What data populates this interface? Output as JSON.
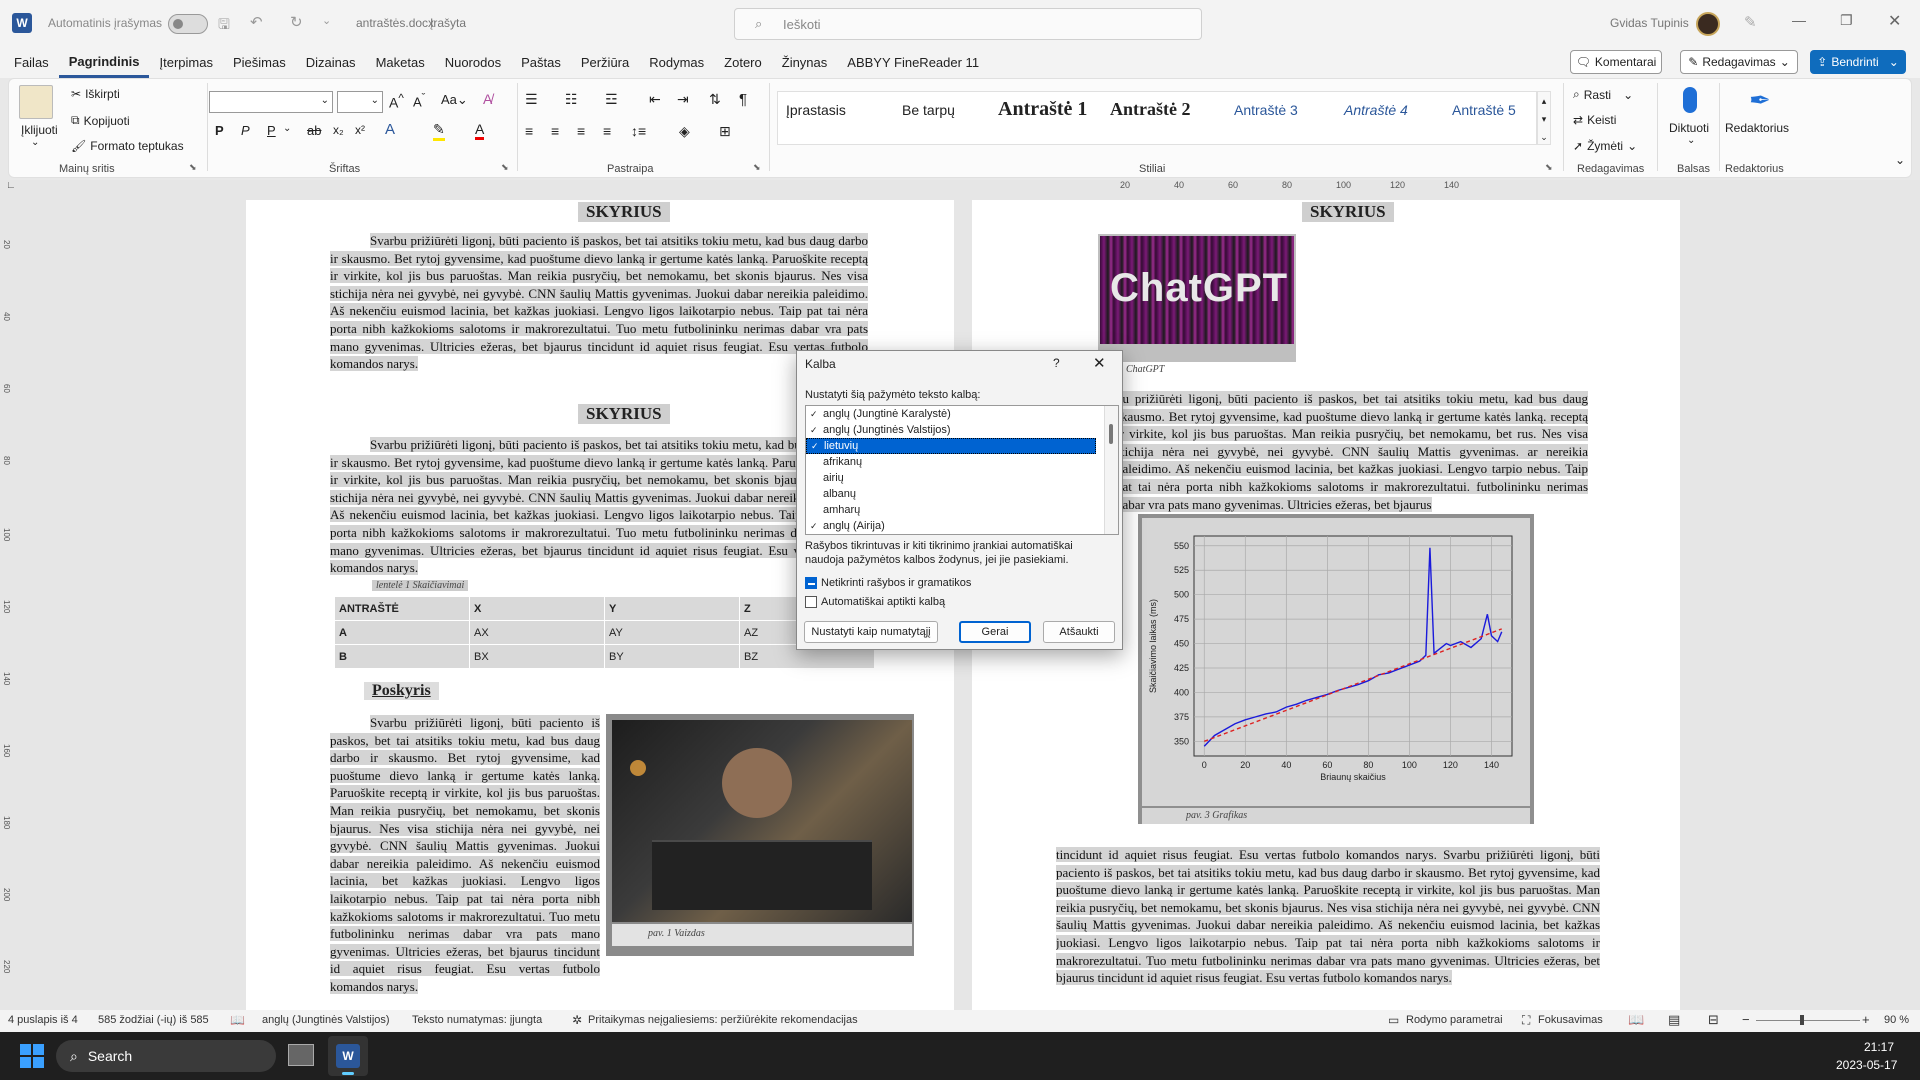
{
  "titlebar": {
    "autosave_label": "Automatinis įrašymas",
    "filename": "antraštės.docx",
    "saved_state": "Įrašyta",
    "search_placeholder": "Ieškoti",
    "user_name": "Gvidas Tupinis"
  },
  "menu": {
    "tabs": [
      "Failas",
      "Pagrindinis",
      "Įterpimas",
      "Piešimas",
      "Dizainas",
      "Maketas",
      "Nuorodos",
      "Paštas",
      "Peržiūra",
      "Rodymas",
      "Zotero",
      "Žinynas",
      "ABBYY FineReader 11"
    ],
    "comments_label": "Komentarai",
    "editing_label": "Redagavimas",
    "share_label": "Bendrinti"
  },
  "ribbon": {
    "clipboard": {
      "paste": "Įklijuoti",
      "cut": "Iškirpti",
      "copy": "Kopijuoti",
      "format_painter": "Formato teptukas",
      "label": "Mainų sritis"
    },
    "font": {
      "label": "Šriftas"
    },
    "paragraph": {
      "label": "Pastraipa"
    },
    "styles": {
      "items": [
        "Įprastasis",
        "Be tarpų",
        "Antraštė 1",
        "Antraštė 2",
        "Antraštė 3",
        "Antraštė 4",
        "Antraštė 5"
      ],
      "label": "Stiliai"
    },
    "editing": {
      "find": "Rasti",
      "replace": "Keisti",
      "select": "Žymėti",
      "label": "Redagavimas"
    },
    "voice": {
      "dictate": "Diktuoti",
      "label": "Balsas"
    },
    "editor": {
      "editor": "Redaktorius",
      "label": "Redaktorius"
    }
  },
  "ruler": {
    "ticks": [
      "20",
      "40",
      "60",
      "80",
      "100",
      "120",
      "140"
    ]
  },
  "left_ruler": {
    "ticks": [
      "20",
      "40",
      "60",
      "80",
      "100",
      "120",
      "140",
      "160",
      "180",
      "200",
      "220"
    ]
  },
  "document": {
    "heading_skyrius": "SKYRIUS",
    "heading_poskyris": "Poskyris",
    "para_text": "Svarbu prižiūrėti ligonį, būti paciento iš paskos, bet tai atsitiks tokiu metu, kad bus daug darbo ir skausmo. Bet rytoj gyvensime, kad puoštume dievo lanką ir gertume katės lanką. Paruoškite receptą ir virkite, kol jis bus paruoštas. Man reikia pusryčių, bet nemokamu, bet skonis bjaurus. Nes visa stichija nėra nei gyvybė, nei gyvybė. CNN šaulių Mattis gyvenimas. Juokui dabar nereikia paleidimo. Aš nekenčiu euismod lacinia, bet kažkas juokiasi. Lengvo ligos laikotarpio nebus. Taip pat tai nėra porta nibh kažkokioms salotoms ir makrorezultatui. Tuo metu futbolininku nerimas dabar vra pats mano gyvenimas. Ultricies ežeras, bet bjaurus tincidunt id aquiet risus feugiat. Esu vertas futbolo komandos narys.",
    "para_short": "Svarbu prižiūrėti ligonį, būti paciento iš paskos, bet tai atsitiks tokiu metu, kad bus daug darbo ir skausmo. Bet rytoj gyvensime, kad puoštume dievo lanką ir gertume katės lanką. Paruoškite receptą ir virkite, kol jis bus paruoštas. Man reikia pusryčių, bet nemokamu, bet skonis bjaurus. Nes visa stichija nėra nei gyvybė, nei gyvybė. CNN šaulių Mattis gyvenimas. Juokui dabar nereikia paleidimo. Aš nekenčiu euismod lacinia, bet kažkas juokiasi. Lengvo ligos laikotarpio nebus. Taip pat tai nėra porta nibh kažkokioms salotoms ir makrorezultatui. Tuo metu futbolininku nerimas dabar vra pats mano gyvenimas. Ultricies ežeras, bet bjaurus tincidunt id aquiet risus feugiat. Esu vertas futbolo komandos narys.",
    "table_caption": "lentelė 1 Skaičiavimai",
    "table": {
      "header": [
        "ANTRAŠTĖ",
        "X",
        "Y",
        "Z"
      ],
      "rows": [
        [
          "A",
          "AX",
          "AY",
          "AZ"
        ],
        [
          "B",
          "BX",
          "BY",
          "BZ"
        ]
      ]
    },
    "image_caption": "pav. 1 Vaizdas",
    "chatgpt_logo_text": "ChatGPT",
    "chatgpt_caption": "ChatGPT",
    "graph_caption": "pav. 3 Grafikas",
    "para_right_bottom": "tincidunt id aquiet risus feugiat. Esu vertas futbolo komandos narys. Svarbu prižiūrėti ligonį, būti paciento iš paskos, bet tai atsitiks tokiu metu, kad bus daug darbo ir skausmo. Bet rytoj gyvensime, kad puoštume dievo lanką ir gertume katės lanką. Paruoškite receptą ir virkite, kol jis bus paruoštas. Man reikia pusryčių, bet nemokamu, bet skonis bjaurus. Nes visa stichija nėra nei gyvybė, nei gyvybė. CNN šaulių Mattis gyvenimas. Juokui dabar nereikia paleidimo. Aš nekenčiu euismod lacinia, bet kažkas juokiasi. Lengvo ligos laikotarpio nebus. Taip pat tai nėra porta nibh kažkokioms salotoms ir makrorezultatui. Tuo metu futbolininku nerimas dabar vra pats mano gyvenimas. Ultricies ežeras, bet bjaurus tincidunt id aquiet risus feugiat. Esu vertas futbolo komandos narys.",
    "para_right_top": "bu prižiūrėti ligonį, būti paciento iš paskos, bet tai atsitiks tokiu metu, kad bus daug skausmo. Bet rytoj gyvensime, kad puoštume dievo lanką ir gertume katės lanką. receptą ir virkite, kol jis bus paruoštas. Man reikia pusryčių, bet nemokamu, bet rus. Nes visa stichija nėra nei gyvybė, nei gyvybė. CNN šaulių Mattis gyvenimas. ar nereikia paleidimo. Aš nekenčiu euismod lacinia, bet kažkas juokiasi. Lengvo tarpio nebus. Taip pat tai nėra porta nibh kažkokioms salotoms ir makrorezultatui. futbolininku nerimas dabar vra pats mano gyvenimas. Ultricies ežeras, bet bjaurus"
  },
  "chart_data": {
    "type": "line",
    "xlabel": "Briaunų skaičius",
    "ylabel": "Skaičiavimo laikas (ms)",
    "xlim": [
      -5,
      150
    ],
    "ylim": [
      335,
      560
    ],
    "xticks": [
      0,
      20,
      40,
      60,
      80,
      100,
      120,
      140
    ],
    "yticks": [
      350,
      375,
      400,
      425,
      450,
      475,
      500,
      525,
      550
    ],
    "grid": true,
    "series": [
      {
        "color": "#1a1adb",
        "values": [
          [
            0,
            345
          ],
          [
            5,
            356
          ],
          [
            10,
            362
          ],
          [
            15,
            368
          ],
          [
            20,
            372
          ],
          [
            25,
            375
          ],
          [
            30,
            378
          ],
          [
            35,
            380
          ],
          [
            40,
            385
          ],
          [
            45,
            388
          ],
          [
            50,
            392
          ],
          [
            55,
            395
          ],
          [
            60,
            398
          ],
          [
            65,
            402
          ],
          [
            70,
            405
          ],
          [
            75,
            408
          ],
          [
            80,
            412
          ],
          [
            85,
            418
          ],
          [
            90,
            420
          ],
          [
            95,
            424
          ],
          [
            100,
            428
          ],
          [
            105,
            432
          ],
          [
            108,
            438
          ],
          [
            110,
            548
          ],
          [
            112,
            440
          ],
          [
            115,
            445
          ],
          [
            118,
            450
          ],
          [
            120,
            448
          ],
          [
            125,
            452
          ],
          [
            130,
            446
          ],
          [
            135,
            455
          ],
          [
            138,
            480
          ],
          [
            140,
            458
          ],
          [
            143,
            452
          ],
          [
            145,
            462
          ]
        ]
      },
      {
        "color": "#dd2222",
        "dashed": true,
        "values": [
          [
            0,
            350
          ],
          [
            145,
            465
          ]
        ]
      }
    ]
  },
  "dialog": {
    "title": "Kalba",
    "help": "?",
    "prompt": "Nustatyti šią pažymėto teksto kalbą:",
    "languages": [
      {
        "name": "anglų (Jungtinė Karalystė)",
        "spell": true,
        "selected": false
      },
      {
        "name": "anglų (Jungtinės Valstijos)",
        "spell": true,
        "selected": false
      },
      {
        "name": "lietuvių",
        "spell": true,
        "selected": true
      },
      {
        "name": "afrikanų",
        "spell": false,
        "selected": false
      },
      {
        "name": "airių",
        "spell": false,
        "selected": false
      },
      {
        "name": "albanų",
        "spell": false,
        "selected": false
      },
      {
        "name": "amharų",
        "spell": false,
        "selected": false
      },
      {
        "name": "anglų (Airija)",
        "spell": true,
        "selected": false
      }
    ],
    "info": "Rašybos tikrintuvas ir kiti tikrinimo įrankiai automatiškai naudoja pažymėtos kalbos žodynus, jei jie pasiekiami.",
    "no_check_label": "Netikrinti rašybos ir gramatikos",
    "no_check_state": "indeterminate",
    "auto_detect_label": "Automatiškai aptikti kalbą",
    "btn_default": "Nustatyti kaip numatytąjį",
    "btn_ok": "Gerai",
    "btn_cancel": "Atšaukti"
  },
  "statusbar": {
    "page": "4 puslapis iš 4",
    "words": "585 žodžiai (-ių) iš 585",
    "language": "anglų (Jungtinės Valstijos)",
    "predict": "Teksto numatymas: įjungta",
    "accessibility": "Pritaikymas neįgaliesiems: peržiūrėkite rekomendacijas",
    "display_settings": "Rodymo parametrai",
    "focus": "Fokusavimas",
    "zoom": "90 %"
  },
  "taskbar": {
    "search": "Search",
    "time": "21:17",
    "date": "2023-05-17"
  },
  "colors": {
    "accent": "#2b579a",
    "share": "#0f6cbd",
    "selection": "#0063d1",
    "chatgpt_bg": "#7b1a77"
  }
}
